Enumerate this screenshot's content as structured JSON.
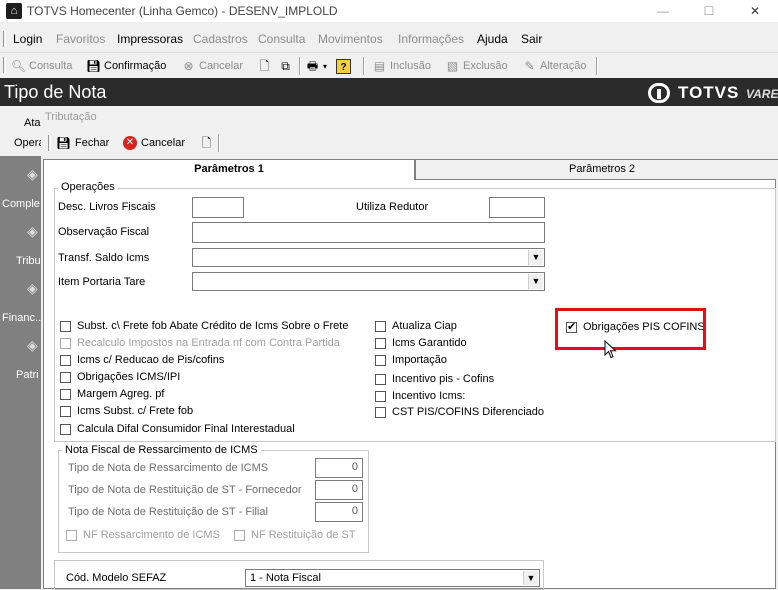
{
  "window": {
    "title": "TOTVS Homecenter (Linha Gemco) - DESENV_IMPLOLD",
    "controls": [
      "—",
      "☐",
      "✕"
    ]
  },
  "menu": [
    {
      "label": "Login",
      "disabled": false
    },
    {
      "label": "Favoritos",
      "disabled": true
    },
    {
      "label": "Impressoras",
      "disabled": false
    },
    {
      "label": "Cadastros",
      "disabled": true
    },
    {
      "label": "Consulta",
      "disabled": true
    },
    {
      "label": "Movimentos",
      "disabled": true
    },
    {
      "label": "Informações",
      "disabled": true
    },
    {
      "label": "Ajuda",
      "disabled": false
    },
    {
      "label": "Sair",
      "disabled": false
    }
  ],
  "toolbar": {
    "consulta": "Consulta",
    "confirmacao": "Confirmação",
    "cancelar": "Cancelar",
    "inclusao": "Inclusão",
    "exclusao": "Exclusão",
    "alteracao": "Alteração"
  },
  "header": {
    "title": "Tipo de Nota",
    "brand": "TOTVS",
    "brand_sub": "VAREJ"
  },
  "background": {
    "tab_partial_1": "Ata",
    "tab_partial_2": "Opera",
    "sidebar": [
      "Comple",
      "Tribu",
      "Financ...",
      "Patri"
    ]
  },
  "dialog": {
    "title": "Tributação",
    "fechar": "Fechar",
    "cancelar": "Cancelar",
    "tabs": [
      "Parâmetros 1",
      "Parâmetros 2"
    ],
    "operacoes": {
      "title": "Operações",
      "desc_livros_label": "Desc. Livros Fiscais",
      "utiliza_redutor_label": "Utiliza Redutor",
      "observacao_label": "Observação Fiscal",
      "transf_saldo_label": "Transf. Saldo Icms",
      "item_portaria_label": "Item Portaria Tare"
    },
    "checks_left": [
      {
        "label": "Subst. c\\ Frete fob Abate Crédito de Icms Sobre o Frete",
        "checked": false,
        "disabled": false
      },
      {
        "label": "Recalculo Impostos na Entrada nf com Contra Partida",
        "checked": false,
        "disabled": true
      },
      {
        "label": "Icms c/ Reducao de Pis/cofins",
        "checked": false,
        "disabled": false
      },
      {
        "label": "Obrigações ICMS/IPI",
        "checked": false,
        "disabled": false
      },
      {
        "label": "Margem Agreg. pf",
        "checked": false,
        "disabled": false
      },
      {
        "label": "Icms Subst. c/ Frete fob",
        "checked": false,
        "disabled": false
      },
      {
        "label": "Calcula Difal Consumidor Final Interestadual",
        "checked": false,
        "disabled": false
      }
    ],
    "checks_mid": [
      {
        "label": "Atualiza Ciap",
        "checked": false
      },
      {
        "label": "Icms Garantido",
        "checked": false
      },
      {
        "label": "Importação",
        "checked": false
      },
      {
        "label": "Incentivo pis - Cofins",
        "checked": false
      },
      {
        "label": "Incentivo Icms:",
        "checked": false
      },
      {
        "label": "CST PIS/COFINS Diferenciado",
        "checked": false
      }
    ],
    "obrigacoes_pis": {
      "label": "Obrigações PIS COFINS",
      "checked": true
    },
    "ressarcimento": {
      "title": "Nota Fiscal de Ressarcimento de ICMS",
      "rows": [
        {
          "label": "Tipo de Nota de Ressarcimento de ICMS",
          "value": "0"
        },
        {
          "label": "Tipo de Nota de Restituição de ST - Fornecedor",
          "value": "0"
        },
        {
          "label": "Tipo de Nota de Restituição de ST - Filial",
          "value": "0"
        }
      ],
      "nf_ressarcimento": "NF Ressarcimento de ICMS",
      "nf_restituicao": "NF Restituição de ST"
    },
    "sefaz": {
      "label": "Cód. Modelo SEFAZ",
      "value": "1 - Nota Fiscal"
    }
  },
  "colors": {
    "header_bg": "#2b2b2b",
    "highlight": "#e0101a",
    "cancel_red": "#d9241c"
  }
}
